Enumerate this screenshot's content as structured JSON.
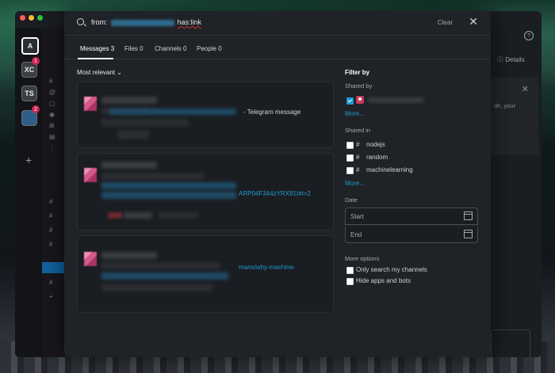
{
  "workspaces": [
    {
      "initial": "A",
      "active": true,
      "badge": ""
    },
    {
      "initial": "XC",
      "active": false,
      "badge": "1"
    },
    {
      "initial": "TS",
      "active": false,
      "badge": ""
    },
    {
      "initial": "",
      "active": false,
      "badge": "2"
    }
  ],
  "rail_add": "+",
  "right_pane": {
    "details_label": "Details",
    "card_text": "de, your",
    "help": "?"
  },
  "search": {
    "query_prefix": "from:",
    "query_suffix": "has:link",
    "clear_label": "Clear",
    "close_glyph": "✕"
  },
  "tabs": [
    {
      "label": "Messages",
      "count": "3"
    },
    {
      "label": "Files",
      "count": "0"
    },
    {
      "label": "Channels",
      "count": "0"
    },
    {
      "label": "People",
      "count": "0"
    }
  ],
  "sort_label": "Most relevant",
  "results": [
    {
      "snippet_text": "- Telegram message",
      "link_text": ""
    },
    {
      "snippet_text": "",
      "link_text": "ARP04F344zYRX91I#t=2"
    },
    {
      "snippet_text": "",
      "link_text": "mans/why-machine-"
    }
  ],
  "filters": {
    "title": "Filter by",
    "shared_by_label": "Shared by",
    "shared_by_more": "More...",
    "shared_in_label": "Shared in",
    "channels": [
      "nodejs",
      "random",
      "machinelearning"
    ],
    "channels_more": "More...",
    "date_label": "Date",
    "date_start_placeholder": "Start",
    "date_end_placeholder": "End",
    "more_options_label": "More options",
    "options": [
      "Only search my channels",
      "Hide apps and bots"
    ]
  },
  "colors": {
    "accent": "#1d9bd1",
    "selected_channel": "#1164a3",
    "badge": "#cd2553"
  }
}
